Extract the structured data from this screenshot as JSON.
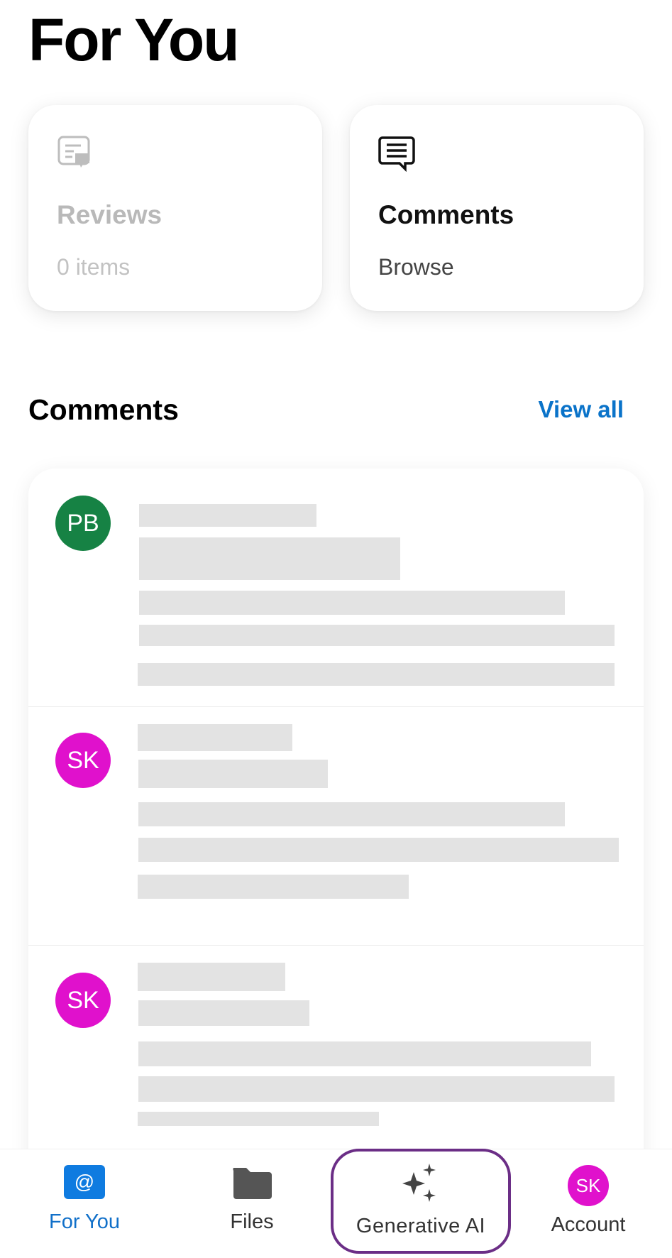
{
  "page": {
    "title": "For You"
  },
  "cards": {
    "reviews": {
      "title": "Reviews",
      "subtitle": "0 items",
      "icon": "reviews-icon"
    },
    "comments": {
      "title": "Comments",
      "subtitle": "Browse",
      "icon": "comments-icon"
    }
  },
  "comments_section": {
    "title": "Comments",
    "view_all": "View all",
    "items": [
      {
        "initials": "PB",
        "avatar_color": "#168244"
      },
      {
        "initials": "SK",
        "avatar_color": "#e011cc"
      },
      {
        "initials": "SK",
        "avatar_color": "#e011cc"
      }
    ]
  },
  "bottom_nav": {
    "items": [
      {
        "label": "For You",
        "icon": "at-sign-icon",
        "active": true
      },
      {
        "label": "Files",
        "icon": "folder-icon"
      },
      {
        "label": "Generative AI",
        "icon": "sparkles-icon",
        "highlighted": true
      },
      {
        "label": "Account",
        "icon": "avatar",
        "initials": "SK"
      }
    ]
  },
  "colors": {
    "accent": "#1170c9",
    "link": "#0a73c9",
    "highlight_border": "#6b2e86",
    "skeleton": "#e3e3e3"
  }
}
